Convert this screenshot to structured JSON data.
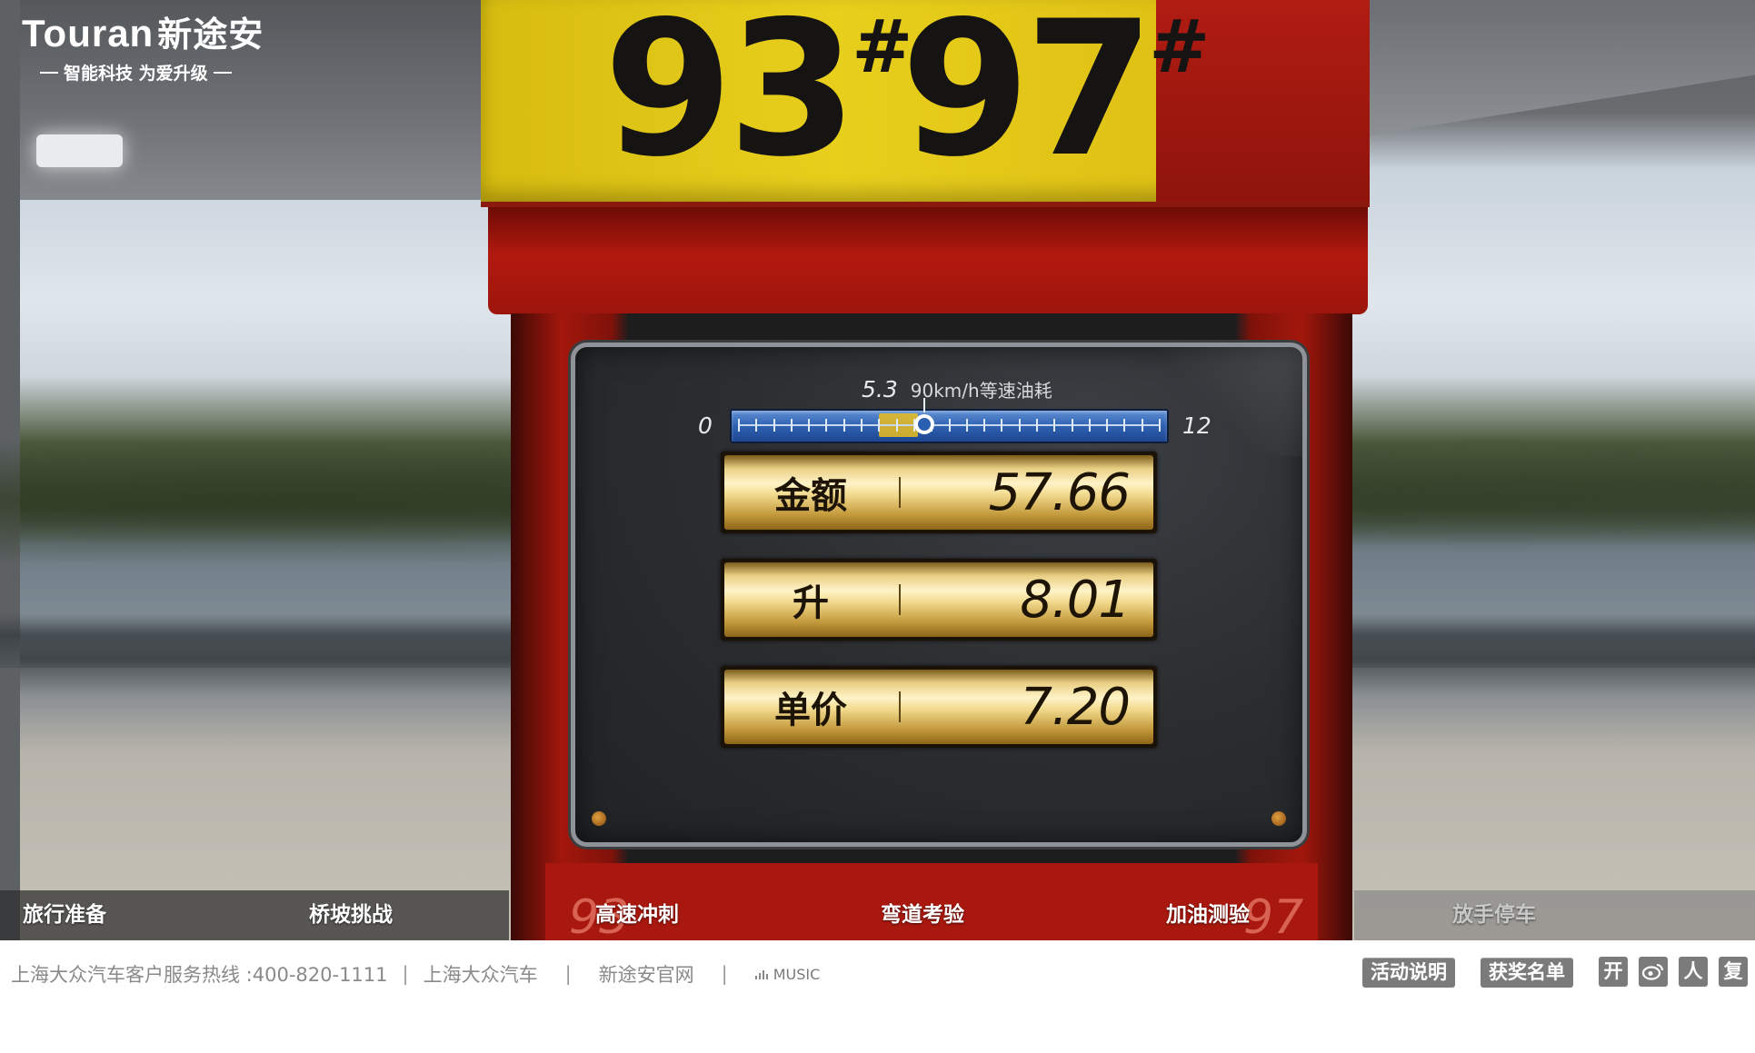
{
  "logo": {
    "brand": "Touran",
    "brand_cn": "新途安",
    "tagline": "智能科技 为爱升级"
  },
  "pump": {
    "fuel_grades": [
      {
        "number": "93",
        "mark": "#"
      },
      {
        "number": "97",
        "mark": "#"
      }
    ],
    "gauge": {
      "value": "5.3",
      "caption": "90km/h等速油耗",
      "min": "0",
      "max": "12",
      "level": 5.3,
      "scale_max": 12,
      "highlight_range": [
        4.0,
        5.1
      ]
    },
    "readouts": [
      {
        "label": "金额",
        "value": "57.66"
      },
      {
        "label": "升",
        "value": "8.01"
      },
      {
        "label": "单价",
        "value": "7.20"
      }
    ],
    "bottom_digits": {
      "left": "93",
      "right": "97"
    }
  },
  "nav": {
    "items": [
      {
        "label": "旅行准备",
        "active": true
      },
      {
        "label": "桥坡挑战",
        "active": true
      },
      {
        "label": "高速冲刺",
        "active": true
      },
      {
        "label": "弯道考验",
        "active": true
      },
      {
        "label": "加油测验",
        "active": true
      },
      {
        "label": "放手停车",
        "active": false
      }
    ]
  },
  "footer": {
    "hotline": "上海大众汽车客户服务热线 :400-820-1111",
    "link_svw": "上海大众汽车",
    "link_official": "新途安官网",
    "music": "MUSIC",
    "btn_rules": "活动说明",
    "btn_winners": "获奖名单",
    "share": [
      "开",
      "",
      "人",
      "复"
    ],
    "share_icons": [
      "kaixin-icon",
      "weibo-icon",
      "renren-icon",
      "fuxin-icon"
    ]
  },
  "colors": {
    "pump_red": "#a8180e",
    "sign_yellow": "#e8cf1c",
    "gauge_blue": "#2f61b0",
    "gold": "#f3dc92"
  }
}
